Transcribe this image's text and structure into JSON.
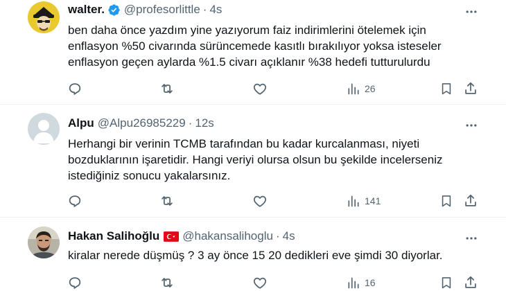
{
  "tweets": [
    {
      "name": "walter.",
      "handle": "@profesorlittle",
      "separator": "·",
      "time": "4s",
      "verified": true,
      "avatar_icon": "walter-avatar-icon",
      "lines": [
        "ben daha önce yazdım yine yazıyorum faiz indirimlerini ötelemek için",
        "enflasyon %50 civarında sürüncemede kasıtlı bırakılıyor yoksa isteseler",
        "enflasyon geçen aylarda %1.5 civarı açıklanır %38 hedefi tutturulurdu"
      ],
      "views": "26"
    },
    {
      "name": "Alpu",
      "handle": "@Alpu26985229",
      "separator": "·",
      "time": "12s",
      "verified": false,
      "avatar_icon": "default-profile-icon",
      "lines": [
        "Herhangi bir verinin TCMB tarafından bu kadar kurcalanması, niyeti",
        "bozduklarının işaretidir. Hangi veriyi olursa olsun bu şekilde incelerseniz",
        "istediğiniz sonucu yakalarsınız."
      ],
      "views": "141"
    },
    {
      "name": "Hakan Salihoğlu",
      "handle": "@hakansalihoglu",
      "separator": "·",
      "time": "4s",
      "verified": false,
      "flag": "turkey-flag-icon",
      "avatar_icon": "hakan-avatar-icon",
      "lines": [
        "kiralar nerede düşmüş ? 3 ay önce 15 20 dedikleri eve şimdi 30 diyorlar."
      ],
      "views": "16"
    }
  ],
  "colors": {
    "text": "#0f1419",
    "secondary": "#536471",
    "verified": "#1d9bf0",
    "divider": "#eff3f4",
    "flag_red": "#e30a17"
  },
  "icons": [
    "more-icon",
    "reply-icon",
    "retweet-icon",
    "like-icon",
    "views-icon",
    "bookmark-icon",
    "share-icon"
  ]
}
